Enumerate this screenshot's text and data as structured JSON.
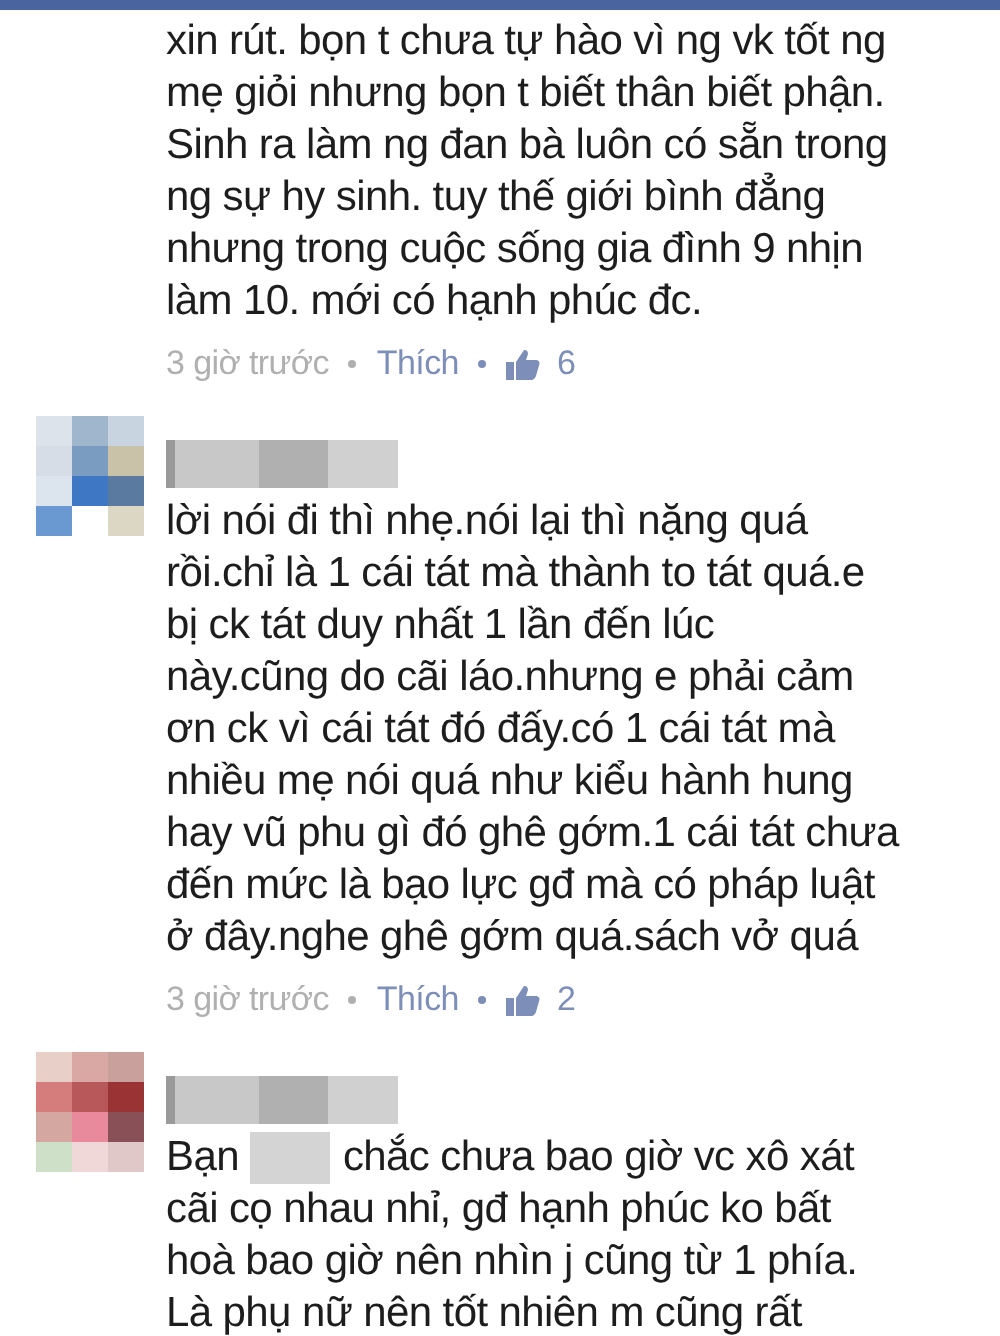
{
  "comments": [
    {
      "has_avatar": false,
      "has_name": false,
      "lines": [
        "xin rút. bọn t chưa tự hào vì ng vk tốt ng",
        "mẹ giỏi nhưng bọn t biết thân biết phận.",
        "Sinh ra làm ng đan bà luôn có sẵn trong",
        "ng sự hy sinh. tuy thế giới bình đẳng",
        "nhưng trong cuộc sống gia đình 9 nhịn",
        "làm 10. mới có hạnh phúc đc."
      ],
      "time": "3 giờ trước",
      "like_label": "Thích",
      "likes": "6"
    },
    {
      "has_avatar": true,
      "has_name": true,
      "lines": [
        "lời nói đi thì nhẹ.nói lại thì nặng quá",
        "rồi.chỉ là 1 cái tát mà thành to tát quá.e",
        "bị ck tát duy nhất 1 lần đến lúc",
        "này.cũng do cãi láo.nhưng e phải cảm",
        "ơn ck vì cái tát đó đấy.có 1 cái tát mà",
        "nhiều mẹ nói quá như kiểu hành hung",
        "hay vũ phu gì đó ghê gớm.1 cái tát chưa",
        "đến mức là bạo lực gđ mà có pháp luật",
        "ở đây.nghe ghê gớm quá.sách vở quá"
      ],
      "time": "3 giờ trước",
      "like_label": "Thích",
      "likes": "2"
    },
    {
      "has_avatar": true,
      "has_name": true,
      "lead": "Bạn",
      "lines": [
        "chắc chưa bao giờ vc xô xát",
        "cãi cọ nhau nhỉ, gđ hạnh phúc ko bất",
        "hoà bao giờ nên nhìn j cũng từ 1 phía.",
        "Là phụ nữ nên tốt nhiên m cũng rất"
      ]
    }
  ]
}
